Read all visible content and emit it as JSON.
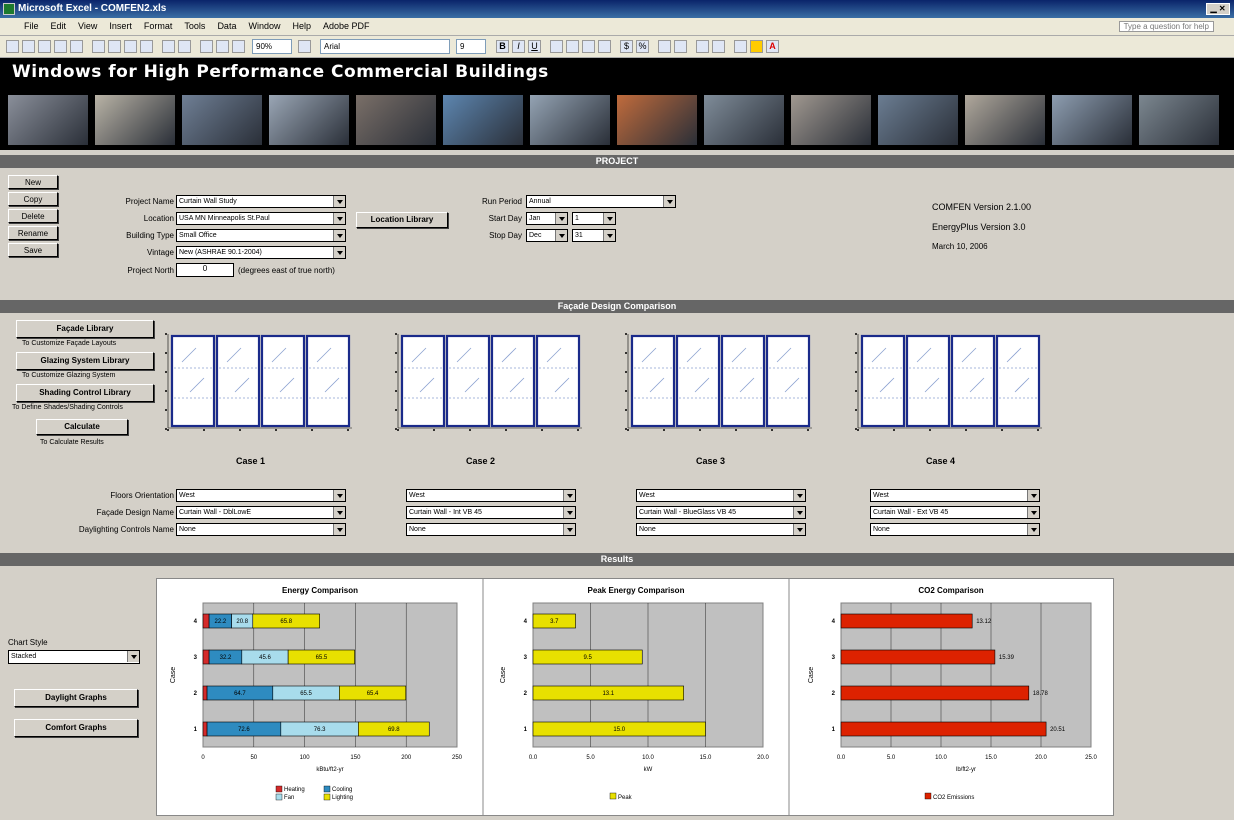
{
  "window": {
    "title": "Microsoft Excel - COMFEN2.xls"
  },
  "menu": {
    "items": [
      "File",
      "Edit",
      "View",
      "Insert",
      "Format",
      "Tools",
      "Data",
      "Window",
      "Help",
      "Adobe PDF"
    ],
    "help_placeholder": "Type a question for help"
  },
  "toolbar": {
    "zoom": "90%",
    "font": "Arial",
    "font_size": "9"
  },
  "banner": {
    "title": "Windows for High Performance Commercial Buildings"
  },
  "sections": {
    "project": "PROJECT",
    "facade": "Façade Design Comparison",
    "results": "Results"
  },
  "left_buttons": [
    "New",
    "Copy",
    "Delete",
    "Rename",
    "Save"
  ],
  "project": {
    "name_label": "Project Name",
    "name_value": "Curtain Wall Study",
    "location_label": "Location",
    "location_value": "USA MN Minneapolis St.Paul",
    "building_label": "Building Type",
    "building_value": "Small Office",
    "vintage_label": "Vintage",
    "vintage_value": "New (ASHRAE 90.1-2004)",
    "north_label": "Project North",
    "north_value": "0",
    "north_unit": "(degrees east of true north)",
    "location_library": "Location Library",
    "run_period_label": "Run Period",
    "run_period_value": "Annual",
    "start_label": "Start Day",
    "start_month": "Jan",
    "start_day": "1",
    "stop_label": "Stop Day",
    "stop_month": "Dec",
    "stop_day": "31",
    "version1": "COMFEN Version 2.1.00",
    "version2": "EnergyPlus Version 3.0",
    "version_date": "March 10, 2006"
  },
  "facade": {
    "facade_library": "Façade Library",
    "facade_note": "To Customize Façade Layouts",
    "glazing_library": "Glazing System Library",
    "glazing_note": "To Customize Glazing System",
    "shading_library": "Shading Control Library",
    "shading_note": "To Define Shades/Shading Controls",
    "calculate": "Calculate",
    "calculate_note": "To Calculate Results",
    "orientation_label": "Floors Orientation",
    "design_label": "Façade Design Name",
    "daylighting_label": "Daylighting Controls Name",
    "cases": [
      {
        "name": "Case 1",
        "orientation": "West",
        "design": "Curtain Wall - DblLowE",
        "daylighting": "None"
      },
      {
        "name": "Case 2",
        "orientation": "West",
        "design": "Curtain Wall - Int VB 45",
        "daylighting": "None"
      },
      {
        "name": "Case 3",
        "orientation": "West",
        "design": "Curtain Wall - BlueGlass VB 45",
        "daylighting": "None"
      },
      {
        "name": "Case 4",
        "orientation": "West",
        "design": "Curtain Wall - Ext VB 45",
        "daylighting": "None"
      }
    ]
  },
  "results": {
    "chart_style_label": "Chart Style",
    "chart_style_value": "Stacked",
    "daylight_button": "Daylight Graphs",
    "comfort_button": "Comfort Graphs"
  },
  "colors": {
    "heating": "#d42a2a",
    "cooling": "#2e8bc0",
    "fan": "#a8dcec",
    "lighting": "#e8e000",
    "co2": "#dd2200",
    "frame": "#1a2a8a"
  },
  "chart_data": [
    {
      "type": "bar",
      "orientation": "horizontal",
      "stacked": true,
      "title": "Energy Comparison",
      "xlabel": "kBtu/ft2-yr",
      "ylabel": "Case",
      "categories": [
        "1",
        "2",
        "3",
        "4"
      ],
      "xlim": [
        0,
        250
      ],
      "xticks": [
        "0",
        "50",
        "100",
        "150",
        "200",
        "250"
      ],
      "series": [
        {
          "name": "Heating",
          "values": [
            4,
            4,
            6,
            6
          ]
        },
        {
          "name": "Cooling",
          "values": [
            72.6,
            64.7,
            32.2,
            22.2
          ]
        },
        {
          "name": "Fan",
          "values": [
            76.3,
            65.5,
            45.6,
            20.8
          ]
        },
        {
          "name": "Lighting",
          "values": [
            69.8,
            65.4,
            65.5,
            65.8
          ]
        }
      ],
      "data_labels": {
        "Cooling": [
          "72.6",
          "64.7",
          "32.2",
          "22.2"
        ],
        "Fan": [
          "76.3",
          "65.5",
          "45.6",
          "20.8"
        ],
        "Lighting": [
          "69.8",
          "65.4",
          "65.5",
          "65.8"
        ]
      },
      "legend": "bottom"
    },
    {
      "type": "bar",
      "orientation": "horizontal",
      "title": "Peak Energy Comparison",
      "xlabel": "kW",
      "ylabel": "Case",
      "categories": [
        "1",
        "2",
        "3",
        "4"
      ],
      "xlim": [
        0,
        20
      ],
      "xticks": [
        "0.0",
        "5.0",
        "10.0",
        "15.0",
        "20.0"
      ],
      "series": [
        {
          "name": "Peak",
          "values": [
            15.0,
            13.1,
            9.5,
            3.7
          ]
        }
      ],
      "data_labels": [
        "15.0",
        "13.1",
        "9.5",
        "3.7"
      ],
      "legend": "bottom"
    },
    {
      "type": "bar",
      "orientation": "horizontal",
      "title": "CO2 Comparison",
      "xlabel": "lb/ft2-yr",
      "ylabel": "Case",
      "categories": [
        "1",
        "2",
        "3",
        "4"
      ],
      "xlim": [
        0,
        25
      ],
      "xticks": [
        "0.0",
        "5.0",
        "10.0",
        "15.0",
        "20.0",
        "25.0"
      ],
      "series": [
        {
          "name": "CO2 Emissions",
          "values": [
            20.51,
            18.78,
            15.39,
            13.12
          ]
        }
      ],
      "data_labels": [
        "20.51",
        "18.78",
        "15.39",
        "13.12"
      ],
      "legend": "bottom"
    }
  ]
}
